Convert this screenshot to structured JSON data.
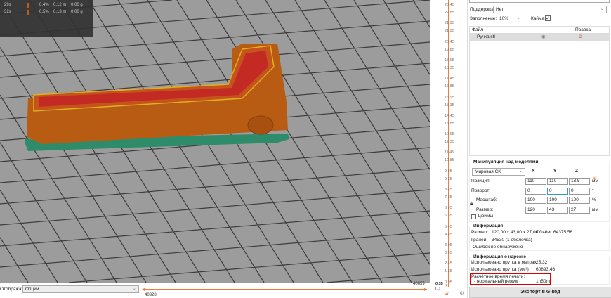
{
  "legend": {
    "rows": [
      {
        "time": "29s",
        "percent": "0,4%",
        "length": "0,12 m",
        "weight": "0,00 g"
      },
      {
        "time": "32s",
        "percent": "0,5%",
        "length": "0,13 m",
        "weight": "0,00 g"
      }
    ]
  },
  "bottom": {
    "display_label": "Отображать",
    "display_value": "Опции",
    "range_max": "40659",
    "range_min": "40328"
  },
  "slider": {
    "ticks": [
      "23,45",
      "22,85",
      "21,95",
      "21,35",
      "20,45",
      "19,85",
      "18,95",
      "18,35",
      "17,45",
      "16,85",
      "15,95",
      "15,35",
      "14,45",
      "13,85",
      "12,95",
      "12,35",
      "11,45",
      "10,85",
      "9,95",
      "9,35",
      "8,45",
      "7,85",
      "6,95",
      "6,35",
      "5,45",
      "4,85",
      "3,95",
      "3,35",
      "2,45",
      "1,85",
      "0,95"
    ],
    "current": "0,35",
    "current_layer": "(1)",
    "accent": "#f07c3c"
  },
  "settings": {
    "supports_label": "Поддержка:",
    "supports_value": "Нет",
    "infill_label": "Заполнение:",
    "infill_value": "10%",
    "brim_label": "Кайма:"
  },
  "objects": {
    "col_file": "Файл",
    "col_edit": "Правка",
    "items": [
      {
        "name": "Ручка.stl"
      }
    ]
  },
  "manip": {
    "title": "Манипуляция над моделями",
    "coord": "Мировая СК",
    "x": "X",
    "y": "Y",
    "z": "Z",
    "rows": [
      {
        "label": "Позиция:",
        "vals": [
          "110",
          "110",
          "13,5"
        ],
        "unit": "мм"
      },
      {
        "label": "Поворот:",
        "vals": [
          "0",
          "0",
          "0"
        ],
        "unit": "°"
      },
      {
        "label": "Масштаб:",
        "vals": [
          "100",
          "100",
          "100"
        ],
        "unit": "%"
      },
      {
        "label": "Размер:",
        "vals": [
          "120",
          "43",
          "27"
        ],
        "unit": "мм"
      }
    ],
    "inches": "Дюймы"
  },
  "info": {
    "title": "Информация",
    "size_label": "Размер:",
    "size": "120,00 x 43,00 x 27,00",
    "volume_label": "Объём:",
    "volume": "64375,56",
    "faces_label": "Граней:",
    "faces": "34530 (1 оболочка)",
    "errors": "Ошибок не обнаружено"
  },
  "slice": {
    "title": "Информация о нарезке",
    "filament_m_label": "Использовано прутка в метрах",
    "filament_m": "25,32",
    "filament_mm3_label": "Использовано прутка (мм³)",
    "filament_mm3": "60893,46",
    "time_label": "Расчётное время печати:",
    "mode_label": "- нормальный режим",
    "time": "1h50m"
  },
  "export": "Экспорт в G-код"
}
